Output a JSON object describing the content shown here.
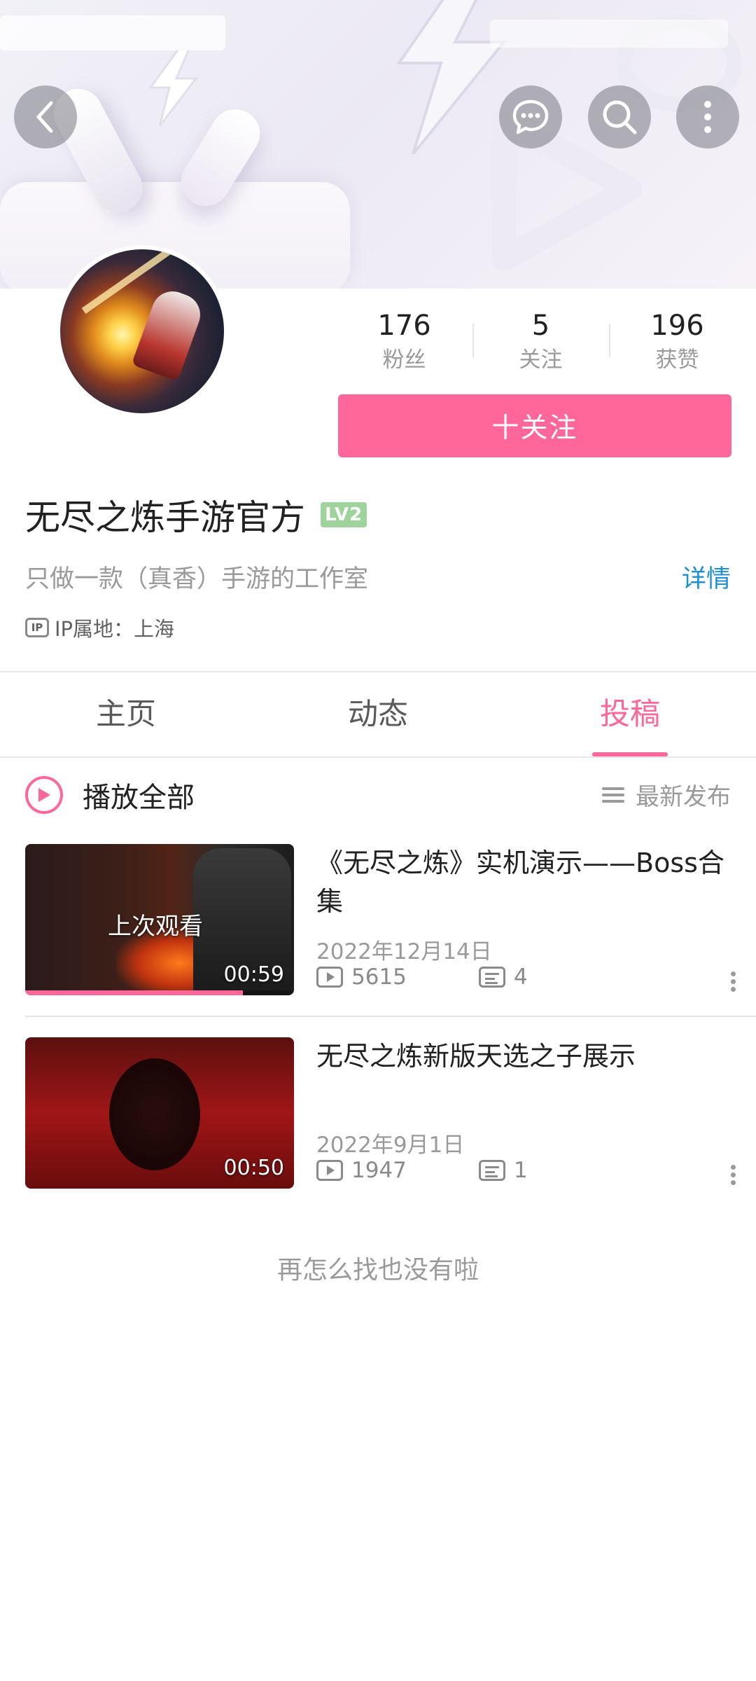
{
  "header": {
    "back_icon": "back-arrow-icon",
    "message_icon": "chat-bubble-icon",
    "search_icon": "search-icon",
    "more_icon": "more-vertical-icon"
  },
  "profile": {
    "stats": [
      {
        "value": "176",
        "label": "粉丝"
      },
      {
        "value": "5",
        "label": "关注"
      },
      {
        "value": "196",
        "label": "获赞"
      }
    ],
    "follow_button": "十关注",
    "name": "无尽之炼手游官方",
    "level_badge": "LV2",
    "signature": "只做一款（真香）手游的工作室",
    "detail_link": "详情",
    "ip_icon_text": "IP",
    "ip_location": "IP属地：上海"
  },
  "tabs": [
    {
      "label": "主页",
      "active": false
    },
    {
      "label": "动态",
      "active": false
    },
    {
      "label": "投稿",
      "active": true
    }
  ],
  "toolbar": {
    "play_all": "播放全部",
    "sort": "最新发布"
  },
  "videos": [
    {
      "title": "《无尽之炼》实机演示——Boss合集",
      "date": "2022年12月14日",
      "views": "5615",
      "danmaku": "4",
      "duration": "00:59",
      "overlay": "上次观看",
      "watch_progress": 0.81
    },
    {
      "title": "无尽之炼新版天选之子展示",
      "date": "2022年9月1日",
      "views": "1947",
      "danmaku": "1",
      "duration": "00:50"
    }
  ],
  "footer": {
    "end_text": "再怎么找也没有啦"
  },
  "colors": {
    "accent": "#ff6699",
    "link": "#1c8fd6",
    "level_badge": "#9ed39c",
    "muted_text": "#9a9a9a"
  }
}
